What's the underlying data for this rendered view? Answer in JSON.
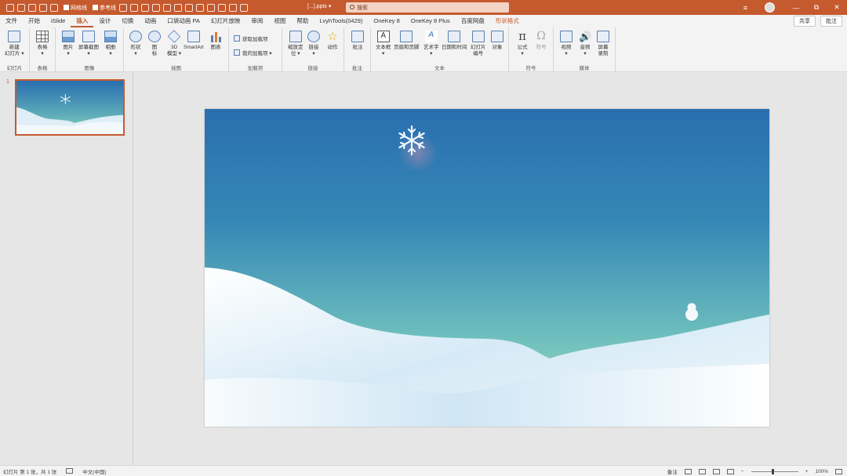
{
  "titlebar": {
    "quick_access": {
      "checkbox1_label": "网格线",
      "checkbox2_label": "参考线"
    },
    "doc_title": "[...].pptx ▾",
    "search_placeholder": "搜索",
    "ribbon_options_icon": "≡",
    "minimize": "—",
    "restore": "⧉",
    "close": "✕"
  },
  "tabs": [
    "文件",
    "开始",
    "iSlide",
    "插入",
    "设计",
    "切换",
    "动画",
    "口袋动画 PA",
    "幻灯片放映",
    "审阅",
    "视图",
    "帮助",
    "LvyhTools(0429)",
    "OneKey 8",
    "OneKey 8 Plus",
    "百度网盘",
    "形状格式"
  ],
  "tab_active": "插入",
  "tabs_right": {
    "share": "共享",
    "comments": "批注"
  },
  "ribbon": {
    "groups": {
      "slides": {
        "label": "幻灯片",
        "new_slide": "新建\n幻灯片 ▾"
      },
      "tables": {
        "label": "表格",
        "table": "表格\n▾"
      },
      "images": {
        "label": "图像",
        "picture": "图片\n▾",
        "screenshot": "屏幕截图\n▾",
        "album": "相册\n▾"
      },
      "illustrations": {
        "label": "插图",
        "shapes": "形状\n▾",
        "icons": "图\n标",
        "model3d": "3D\n模型 ▾",
        "smartart": "SmartArt",
        "chart": "图表"
      },
      "addins": {
        "label": "加载项",
        "get_addins": "获取加载项",
        "my_addins": "我的加载项 ▾"
      },
      "links": {
        "label": "链接",
        "zoom": "缩放定\n位 ▾",
        "link": "链接\n▾",
        "action": "动作"
      },
      "comments": {
        "label": "批注",
        "comment": "批注"
      },
      "text": {
        "label": "文本",
        "textbox": "文本框\n▾",
        "header_footer": "页眉和页脚",
        "wordart": "艺术字\n▾",
        "datetime": "日期和时间",
        "slide_number": "幻灯片\n编号",
        "object": "对象"
      },
      "symbols": {
        "label": "符号",
        "equation": "公式\n▾",
        "symbol": "符号"
      },
      "media": {
        "label": "媒体",
        "video": "视频\n▾",
        "audio": "音频\n▾",
        "screen_recording": "屏幕\n录制"
      }
    }
  },
  "thumbnails": [
    {
      "number": "1"
    }
  ],
  "statusbar": {
    "slide_info": "幻灯片 第 1 张，共 1 张",
    "language": "中文(中国)",
    "notes": "备注",
    "zoom": "100%",
    "zoom_minus": "−",
    "zoom_plus": "+"
  },
  "colors": {
    "accent": "#c55a2e",
    "sky_top": "#2a6fb0",
    "sky_bottom": "#8fd4c0",
    "snow": "#ffffff"
  }
}
